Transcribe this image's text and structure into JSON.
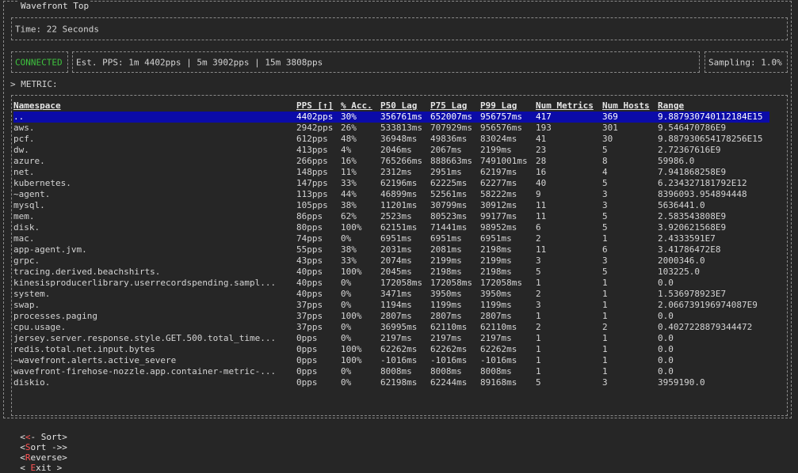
{
  "app": {
    "title": "Wavefront Top"
  },
  "time": {
    "text": "Time: 22 Seconds"
  },
  "status": {
    "connection": "CONNECTED",
    "pps": "Est. PPS: 1m 4402pps | 5m 3902pps | 15m 3808pps",
    "sampling": "Sampling: 1.0%"
  },
  "metric_prompt": "> METRIC:",
  "table": {
    "headers": [
      "Namespace",
      "PPS [↑]",
      "% Acc.",
      "P50 Lag",
      "P75 Lag",
      "P99 Lag",
      "Num Metrics",
      "Num Hosts",
      "Range"
    ],
    "rows": [
      [
        "..",
        "4402pps",
        "30%",
        "356761ms",
        "652007ms",
        "956757ms",
        "417",
        "369",
        "9.887930740112184E15"
      ],
      [
        "aws.",
        "2942pps",
        "26%",
        "533813ms",
        "707929ms",
        "956576ms",
        "193",
        "301",
        "9.546470786E9"
      ],
      [
        "pcf.",
        "612pps",
        "48%",
        "36948ms",
        "49836ms",
        "83024ms",
        "41",
        "30",
        "9.887930654178256E15"
      ],
      [
        "dw.",
        "413pps",
        "4%",
        "2046ms",
        "2067ms",
        "2199ms",
        "23",
        "5",
        "2.72367616E9"
      ],
      [
        "azure.",
        "266pps",
        "16%",
        "765266ms",
        "888663ms",
        "7491001ms",
        "28",
        "8",
        "59986.0"
      ],
      [
        "net.",
        "148pps",
        "11%",
        "2312ms",
        "2951ms",
        "62197ms",
        "16",
        "4",
        "7.941868258E9"
      ],
      [
        "kubernetes.",
        "147pps",
        "33%",
        "62196ms",
        "62225ms",
        "62277ms",
        "40",
        "5",
        "6.234327181792E12"
      ],
      [
        "~agent.",
        "113pps",
        "44%",
        "46899ms",
        "52561ms",
        "58222ms",
        "9",
        "3",
        "8396093.954894448"
      ],
      [
        "mysql.",
        "105pps",
        "38%",
        "11201ms",
        "30799ms",
        "30912ms",
        "11",
        "3",
        "5636441.0"
      ],
      [
        "mem.",
        "86pps",
        "62%",
        "2523ms",
        "80523ms",
        "99177ms",
        "11",
        "5",
        "2.583543808E9"
      ],
      [
        "disk.",
        "80pps",
        "100%",
        "62151ms",
        "71441ms",
        "98952ms",
        "6",
        "5",
        "3.920621568E9"
      ],
      [
        "mac.",
        "74pps",
        "0%",
        "6951ms",
        "6951ms",
        "6951ms",
        "2",
        "1",
        "2.4333591E7"
      ],
      [
        "app-agent.jvm.",
        "55pps",
        "38%",
        "2031ms",
        "2081ms",
        "2198ms",
        "11",
        "6",
        "3.41786472E8"
      ],
      [
        "grpc.",
        "43pps",
        "33%",
        "2074ms",
        "2199ms",
        "2199ms",
        "3",
        "3",
        "2000346.0"
      ],
      [
        "tracing.derived.beachshirts.",
        "40pps",
        "100%",
        "2045ms",
        "2198ms",
        "2198ms",
        "5",
        "5",
        "103225.0"
      ],
      [
        "kinesisproducerlibrary.userrecordspending.sampl...",
        "40pps",
        "0%",
        "172058ms",
        "172058ms",
        "172058ms",
        "1",
        "1",
        "0.0"
      ],
      [
        "system.",
        "40pps",
        "0%",
        "3471ms",
        "3950ms",
        "3950ms",
        "2",
        "1",
        "1.536978923E7"
      ],
      [
        "swap.",
        "37pps",
        "0%",
        "1194ms",
        "1199ms",
        "1199ms",
        "3",
        "1",
        "2.066739196974087E9"
      ],
      [
        "processes.paging",
        "37pps",
        "100%",
        "2807ms",
        "2807ms",
        "2807ms",
        "1",
        "1",
        "0.0"
      ],
      [
        "cpu.usage.",
        "37pps",
        "0%",
        "36995ms",
        "62110ms",
        "62110ms",
        "2",
        "2",
        "0.4027228879344472"
      ],
      [
        "jersey.server.response.style.GET.500.total_time...",
        "0pps",
        "0%",
        "2197ms",
        "2197ms",
        "2197ms",
        "1",
        "1",
        "0.0"
      ],
      [
        "redis.total.net.input.bytes",
        "0pps",
        "100%",
        "62262ms",
        "62262ms",
        "62262ms",
        "1",
        "1",
        "0.0"
      ],
      [
        "~wavefront.alerts.active_severe",
        "0pps",
        "100%",
        "-1016ms",
        "-1016ms",
        "-1016ms",
        "1",
        "1",
        "0.0"
      ],
      [
        "wavefront-firehose-nozzle.app.container-metric-...",
        "0pps",
        "0%",
        "8008ms",
        "8008ms",
        "8008ms",
        "1",
        "1",
        "0.0"
      ],
      [
        "diskio.",
        "0pps",
        "0%",
        "62198ms",
        "62244ms",
        "89168ms",
        "5",
        "3",
        "3959190.0"
      ]
    ]
  },
  "footer": {
    "sort_left": {
      "prefix": "<",
      "hot": "<",
      "rest": "- Sort>"
    },
    "sort_right": {
      "prefix": "<",
      "hot": "S",
      "rest": "ort ->>"
    },
    "reverse": {
      "prefix": "<",
      "hot": "R",
      "rest": "everse>"
    },
    "exit": {
      "prefix": "< ",
      "hot": "E",
      "rest": "xit >"
    }
  }
}
